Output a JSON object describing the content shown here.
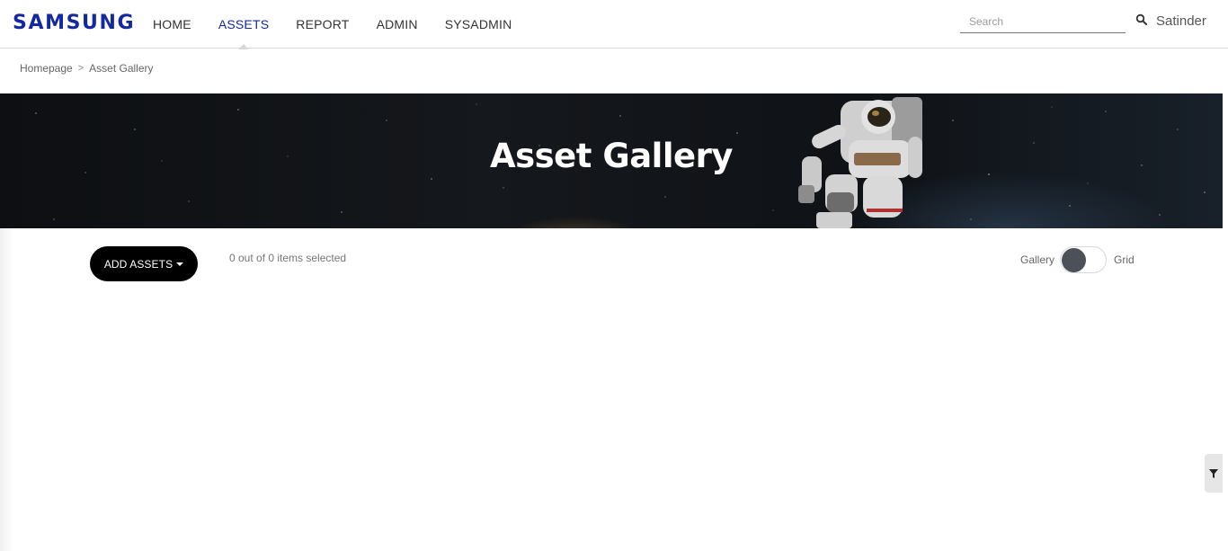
{
  "header": {
    "logo": "SAMSUNG",
    "nav": [
      "HOME",
      "ASSETS",
      "REPORT",
      "ADMIN",
      "SYSADMIN"
    ],
    "active_nav": "ASSETS",
    "search_placeholder": "Search",
    "user_name": "Satinder"
  },
  "breadcrumb": {
    "home": "Homepage",
    "separator": ">",
    "current": "Asset Gallery"
  },
  "hero": {
    "title": "Asset Gallery"
  },
  "toolbar": {
    "add_assets_label": "ADD ASSETS",
    "selection_text": "0 out of 0 items selected",
    "view_toggle": {
      "left_label": "Gallery",
      "right_label": "Grid",
      "selected": "Gallery"
    }
  },
  "filter": {
    "icon": "filter-icon"
  },
  "colors": {
    "brand": "#1428a0",
    "button_bg": "#000000",
    "toggle_knob": "#4b5059"
  }
}
